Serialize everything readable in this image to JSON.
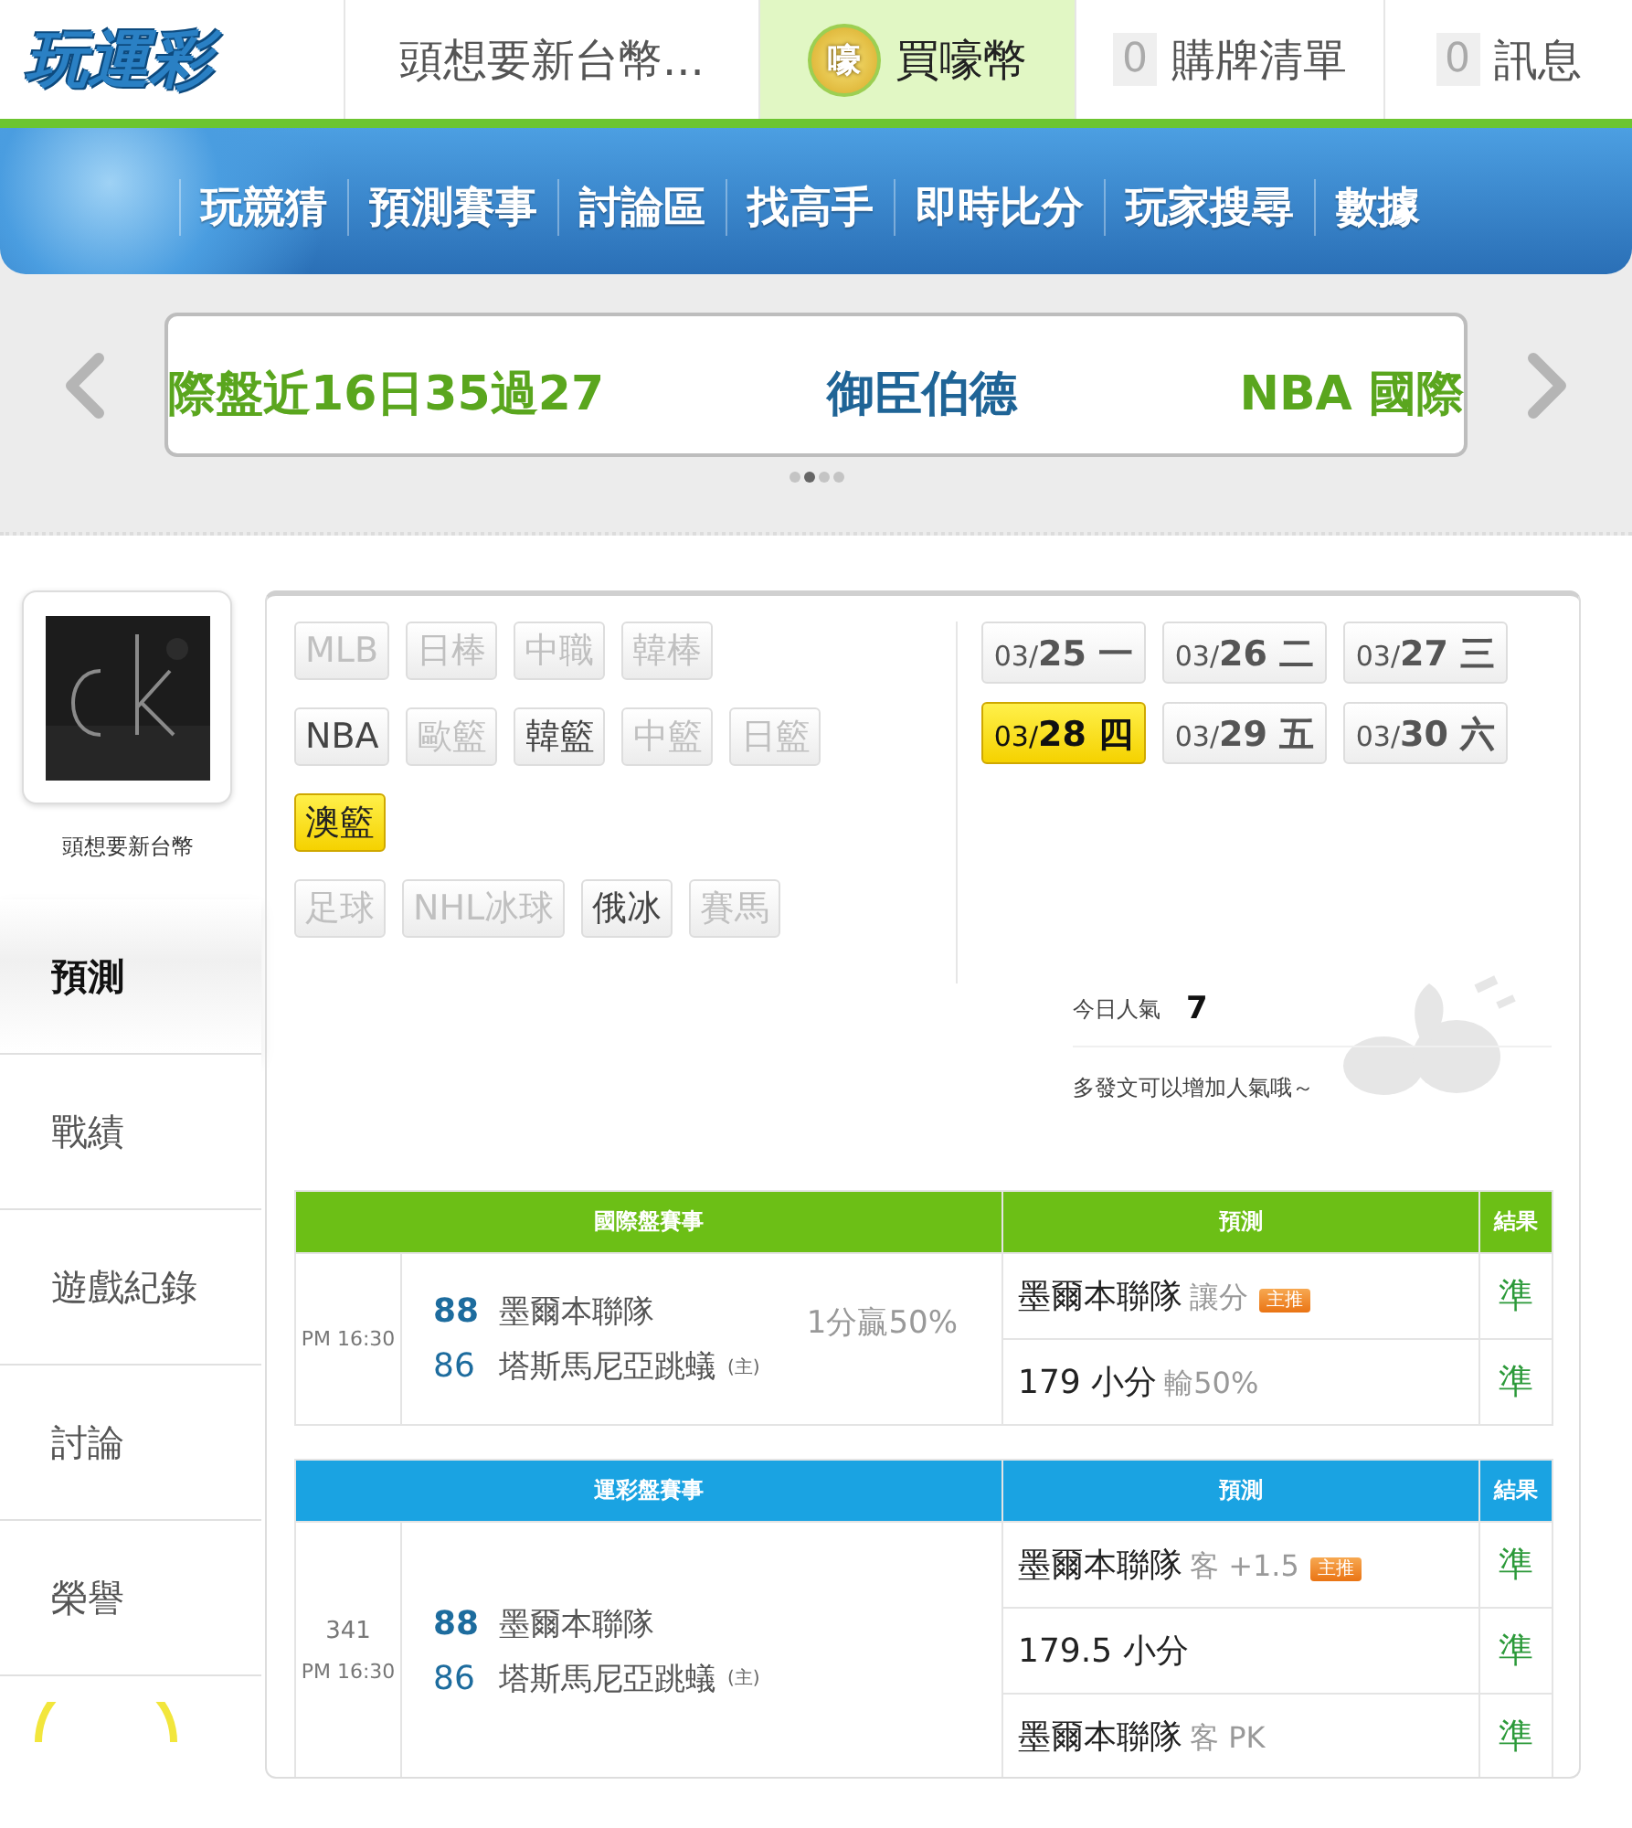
{
  "header": {
    "logo": "玩運彩",
    "tabs": [
      {
        "kind": "user",
        "label": "頭想要新台幣...",
        "selected": false
      },
      {
        "kind": "coin",
        "coin_label": "嚎",
        "label": "買嚎幣",
        "selected": true
      },
      {
        "kind": "count",
        "count": "0",
        "label": "購牌清單",
        "selected": false
      },
      {
        "kind": "count",
        "count": "0",
        "label": "訊息",
        "selected": false
      }
    ]
  },
  "nav": [
    "玩競猜",
    "預測賽事",
    "討論區",
    "找高手",
    "即時比分",
    "玩家搜尋",
    "數據"
  ],
  "carousel": {
    "texts": [
      {
        "text": "際盤近16日35過27",
        "color": "#5aa61e"
      },
      {
        "text": "御臣伯德",
        "color": "#1f6496"
      },
      {
        "text": "NBA 國際",
        "color": "#5aa61e"
      }
    ],
    "dots": [
      {
        "selected": false
      },
      {
        "selected": true
      },
      {
        "selected": false
      },
      {
        "selected": false
      }
    ]
  },
  "sidebar": {
    "username": "頭想要新台幣",
    "menu": [
      {
        "label": "預測",
        "selected": true
      },
      {
        "label": "戰績",
        "selected": false
      },
      {
        "label": "遊戲紀錄",
        "selected": false
      },
      {
        "label": "討論",
        "selected": false
      },
      {
        "label": "榮譽",
        "selected": false
      }
    ]
  },
  "leagues": {
    "rows": [
      [
        {
          "label": "MLB",
          "disabled": true,
          "selected": false
        },
        {
          "label": "日棒",
          "disabled": true,
          "selected": false
        },
        {
          "label": "中職",
          "disabled": true,
          "selected": false
        },
        {
          "label": "韓棒",
          "disabled": true,
          "selected": false
        }
      ],
      [
        {
          "label": "NBA",
          "disabled": false,
          "selected": false
        },
        {
          "label": "歐籃",
          "disabled": true,
          "selected": false
        },
        {
          "label": "韓籃",
          "disabled": false,
          "selected": false
        },
        {
          "label": "中籃",
          "disabled": true,
          "selected": false
        },
        {
          "label": "日籃",
          "disabled": true,
          "selected": false
        }
      ],
      [
        {
          "label": "澳籃",
          "disabled": false,
          "selected": true
        }
      ],
      [
        {
          "label": "足球",
          "disabled": true,
          "selected": false
        },
        {
          "label": "NHL冰球",
          "disabled": true,
          "selected": false
        },
        {
          "label": "俄冰",
          "disabled": false,
          "selected": false
        },
        {
          "label": "賽馬",
          "disabled": true,
          "selected": false
        }
      ]
    ]
  },
  "dates": [
    {
      "month": "03/",
      "day": "25",
      "weekday": "一",
      "selected": false
    },
    {
      "month": "03/",
      "day": "26",
      "weekday": "二",
      "selected": false
    },
    {
      "month": "03/",
      "day": "27",
      "weekday": "三",
      "selected": false
    },
    {
      "month": "03/",
      "day": "28",
      "weekday": "四",
      "selected": true
    },
    {
      "month": "03/",
      "day": "29",
      "weekday": "五",
      "selected": false
    },
    {
      "month": "03/",
      "day": "30",
      "weekday": "六",
      "selected": false
    }
  ],
  "popularity": {
    "label": "今日人氣",
    "value": "7",
    "hint": "多發文可以增加人氣哦～"
  },
  "tables": [
    {
      "color": "#6cbf16",
      "columns": [
        "國際盤賽事",
        "預測",
        "結果"
      ],
      "games": [
        {
          "time": "PM 16:30",
          "teams": [
            {
              "score": "88",
              "name": "墨爾本聯隊",
              "winner": true
            },
            {
              "score": "86",
              "name": "塔斯馬尼亞跳蟻",
              "winner": false,
              "home_mark": "(主)"
            }
          ],
          "note": "1分贏50%",
          "picks": [
            {
              "main": "墨爾本聯隊",
              "detail": "讓分",
              "badge": "主推",
              "result": "準"
            },
            {
              "main": "179 小分",
              "detail": "輸50%",
              "result": "準"
            }
          ]
        }
      ]
    },
    {
      "color": "#1aa3e2",
      "columns": [
        "運彩盤賽事",
        "預測",
        "結果"
      ],
      "games": [
        {
          "number": "341",
          "time": "PM 16:30",
          "teams": [
            {
              "score": "88",
              "name": "墨爾本聯隊",
              "winner": true
            },
            {
              "score": "86",
              "name": "塔斯馬尼亞跳蟻",
              "winner": false,
              "home_mark": "(主)"
            }
          ],
          "picks": [
            {
              "main": "墨爾本聯隊",
              "detail": "客 +1.5",
              "badge": "主推",
              "result": "準"
            },
            {
              "main": "179.5 小分",
              "result": "準"
            },
            {
              "main": "墨爾本聯隊",
              "detail": "客 PK",
              "result": "準"
            }
          ]
        }
      ]
    }
  ]
}
